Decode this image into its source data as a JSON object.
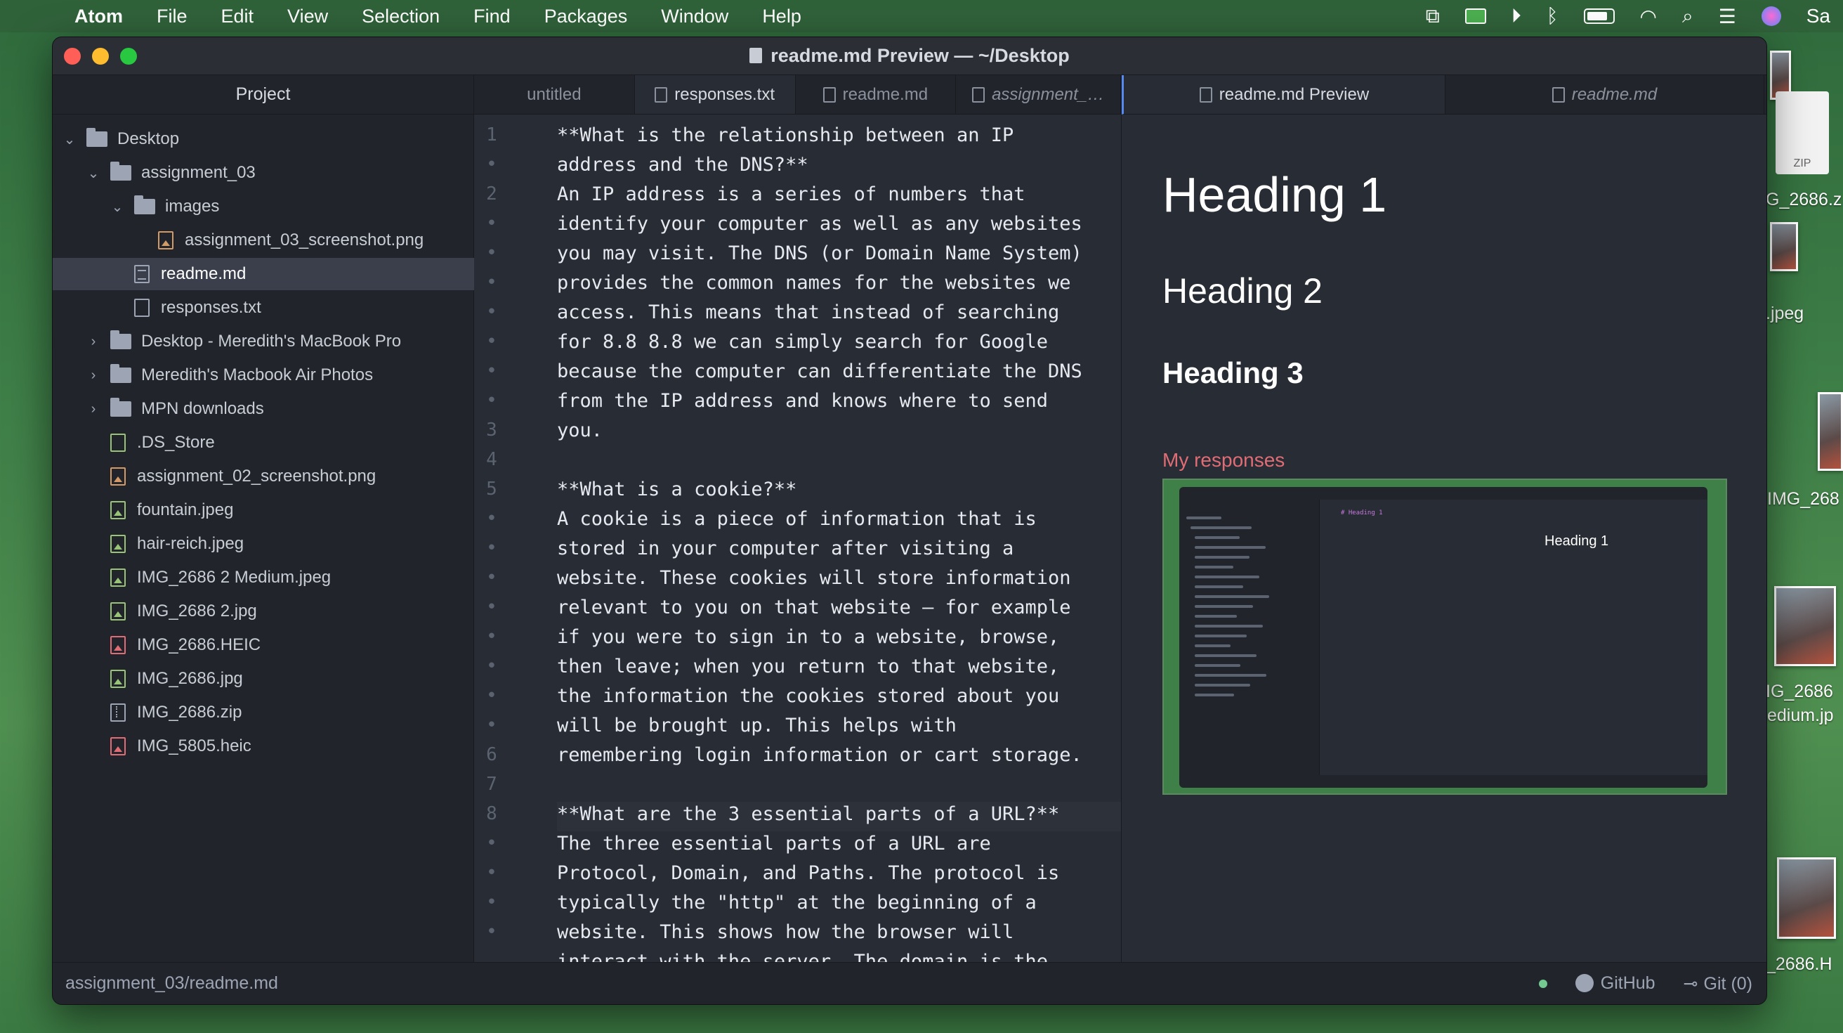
{
  "menubar": {
    "app": "Atom",
    "items": [
      "File",
      "Edit",
      "View",
      "Selection",
      "Find",
      "Packages",
      "Window",
      "Help"
    ],
    "right_truncated": "Sa"
  },
  "desktop": {
    "zip_label": "ZIP",
    "labels": [
      "G_2686.z",
      ".jpeg",
      "IMG_268",
      "IG_2686",
      "edium.jp",
      "_2686.H"
    ]
  },
  "window": {
    "title": "readme.md Preview — ~/Desktop"
  },
  "tree": {
    "header": "Project",
    "rows": [
      {
        "label": "Desktop",
        "kind": "folder",
        "expanded": true,
        "depth": 0
      },
      {
        "label": "assignment_03",
        "kind": "folder",
        "expanded": true,
        "depth": 1
      },
      {
        "label": "images",
        "kind": "folder",
        "expanded": true,
        "depth": 2
      },
      {
        "label": "assignment_03_screenshot.png",
        "kind": "img",
        "depth": 3
      },
      {
        "label": "readme.md",
        "kind": "md",
        "depth": 2,
        "selected": true
      },
      {
        "label": "responses.txt",
        "kind": "txt",
        "depth": 2
      },
      {
        "label": "Desktop - Meredith's MacBook Pro",
        "kind": "folder",
        "expanded": false,
        "depth": 1
      },
      {
        "label": "Meredith's Macbook Air Photos",
        "kind": "folder",
        "expanded": false,
        "depth": 1
      },
      {
        "label": "MPN downloads",
        "kind": "folder",
        "expanded": false,
        "depth": 1
      },
      {
        "label": ".DS_Store",
        "kind": "ds",
        "depth": 1
      },
      {
        "label": "assignment_02_screenshot.png",
        "kind": "img",
        "depth": 1
      },
      {
        "label": "fountain.jpeg",
        "kind": "imgg",
        "depth": 1
      },
      {
        "label": "hair-reich.jpeg",
        "kind": "imgg",
        "depth": 1
      },
      {
        "label": "IMG_2686 2 Medium.jpeg",
        "kind": "imgg",
        "depth": 1
      },
      {
        "label": "IMG_2686 2.jpg",
        "kind": "imgg",
        "depth": 1
      },
      {
        "label": "IMG_2686.HEIC",
        "kind": "heic",
        "depth": 1
      },
      {
        "label": "IMG_2686.jpg",
        "kind": "imgg",
        "depth": 1
      },
      {
        "label": "IMG_2686.zip",
        "kind": "zip",
        "depth": 1
      },
      {
        "label": "IMG_5805.heic",
        "kind": "heic",
        "depth": 1
      }
    ]
  },
  "editor": {
    "tabs": [
      {
        "label": "untitled",
        "active": false,
        "italic": false,
        "icon": false
      },
      {
        "label": "responses.txt",
        "active": true,
        "italic": false,
        "icon": true
      },
      {
        "label": "readme.md",
        "active": false,
        "italic": false,
        "icon": true
      },
      {
        "label": "assignment_…",
        "active": false,
        "italic": true,
        "icon": true
      }
    ],
    "gutter": [
      "1",
      "•",
      "2",
      "•",
      "•",
      "•",
      "•",
      "•",
      "•",
      "•",
      "3",
      "4",
      "5",
      "•",
      "•",
      "•",
      "•",
      "•",
      "•",
      "•",
      "•",
      "6",
      "7",
      "8",
      "•",
      "•",
      "•",
      "•"
    ],
    "cursor_line_index": 23,
    "lines": [
      "**What is the relationship between an IP",
      "address and the DNS?**",
      "An IP address is a series of numbers that",
      "identify your computer as well as any websites",
      "you may visit. The DNS (or Domain Name System)",
      "provides the common names for the websites we",
      "access. This means that instead of searching",
      "for 8.8 8.8 we can simply search for Google",
      "because the computer can differentiate the DNS",
      "from the IP address and knows where to send",
      "you.",
      "",
      "**What is a cookie?**",
      "A cookie is a piece of information that is",
      "stored in your computer after visiting a",
      "website. These cookies will store information",
      "relevant to you on that website – for example",
      "if you were to sign in to a website, browse,",
      "then leave; when you return to that website,",
      "the information the cookies stored about you",
      "will be brought up. This helps with",
      "remembering login information or cart storage.",
      "",
      "**What are the 3 essential parts of a URL?**",
      "The three essential parts of a URL are",
      "Protocol, Domain, and Paths. The protocol is",
      "typically the \"http\" at the beginning of a",
      "website. This shows how the browser will",
      "interact with the server. The domain is the"
    ]
  },
  "preview": {
    "tabs": [
      {
        "label": "readme.md Preview",
        "active": true,
        "italic": false
      },
      {
        "label": "readme.md",
        "active": false,
        "italic": true
      }
    ],
    "h1": "Heading 1",
    "h2": "Heading 2",
    "h3": "Heading 3",
    "link": "My responses",
    "embedded_heading": "Heading 1",
    "embedded_code": "# Heading 1"
  },
  "statusbar": {
    "path": "assignment_03/readme.md",
    "github": "GitHub",
    "git": "Git (0)"
  },
  "colors": {
    "accent_tab": "#568af2",
    "link": "#e06c75",
    "selection": "#3a3f4b"
  }
}
